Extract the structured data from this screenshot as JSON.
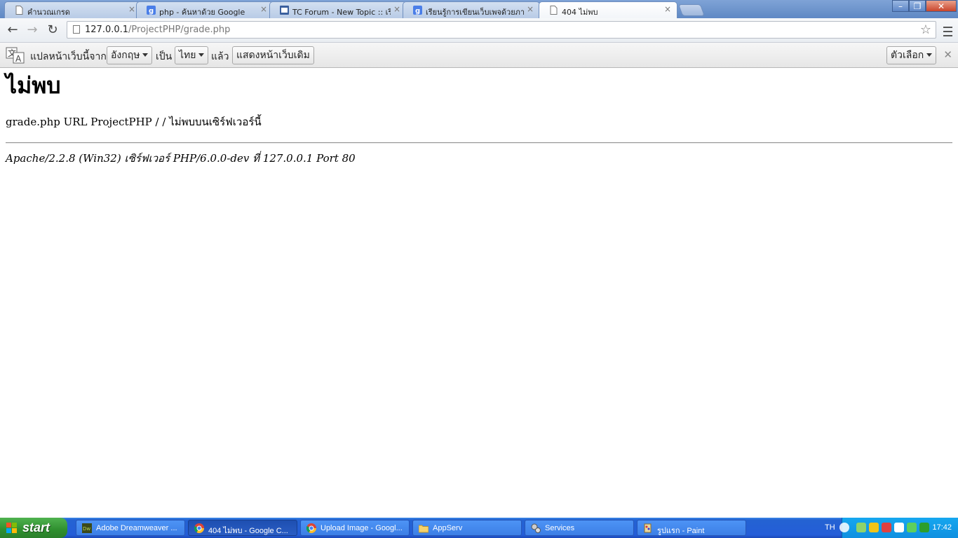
{
  "tabs": [
    {
      "title": "คำนวณเกรด",
      "icon": "page-icon"
    },
    {
      "title": "php - ค้นหาด้วย Google",
      "icon": "google-icon"
    },
    {
      "title": "TC Forum - New Topic :: เริ่มต้",
      "icon": "forum-icon"
    },
    {
      "title": "เรียนรู้การเขียนเว็บเพจด้วยภาษ",
      "icon": "google-icon"
    },
    {
      "title": "404 ไม่พบ",
      "icon": "page-icon"
    }
  ],
  "tab_close": "×",
  "window_controls": {
    "minimize": "–",
    "maximize": "❐",
    "close": "✕"
  },
  "toolbar": {
    "back": "←",
    "forward": "→",
    "reload": "↻",
    "url_host": "127.0.0.1",
    "url_path": "/ProjectPHP/grade.php",
    "star": "☆"
  },
  "translate_bar": {
    "prefix": "แปลหน้าเว็บนี้จาก",
    "from_lang": "อังกฤษ",
    "to_word": "เป็น",
    "to_lang": "ไทย",
    "then_word": "แล้ว",
    "show_original": "แสดงหน้าเว็บเดิม",
    "options": "ตัวเลือก",
    "close": "✕"
  },
  "page": {
    "heading": "ไม่พบ",
    "message": "grade.php URL ProjectPHP / / ไม่พบบนเซิร์ฟเวอร์นี้",
    "server": "Apache/2.2.8 (Win32) เซิร์ฟเวอร์ PHP/6.0.0-dev ที่ 127.0.0.1 Port 80"
  },
  "taskbar": {
    "start": "start",
    "tasks": [
      {
        "label": "Adobe Dreamweaver ...",
        "icon": "dreamweaver-icon",
        "active": false
      },
      {
        "label": "404 ไม่พบ - Google C...",
        "icon": "chrome-icon",
        "active": true
      },
      {
        "label": "Upload Image - Googl...",
        "icon": "chrome-icon",
        "active": false
      },
      {
        "label": "AppServ",
        "icon": "folder-icon",
        "active": false
      },
      {
        "label": "Services",
        "icon": "services-icon",
        "active": false
      },
      {
        "label": "รูปแรก - Paint",
        "icon": "paint-icon",
        "active": false
      }
    ],
    "language": "TH",
    "clock": "17:42"
  },
  "colors": {
    "taskbar_blue": "#245dd8",
    "start_green": "#2f8f2f",
    "tray_blue": "#0f8fe0",
    "chrome_tab_strip": "#5f88c4"
  }
}
